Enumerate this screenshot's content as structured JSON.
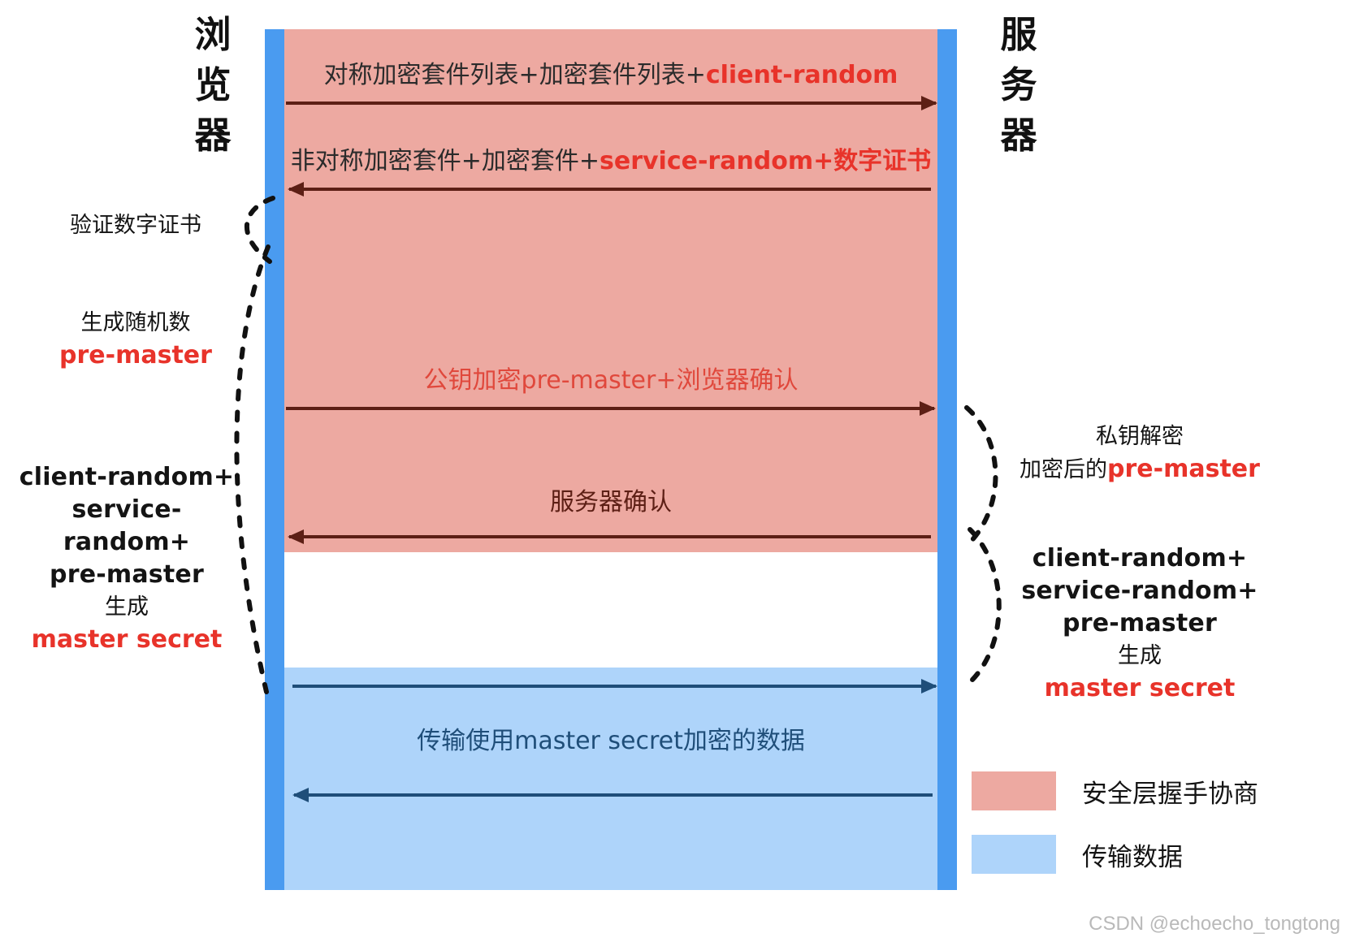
{
  "actors": {
    "left": "浏览器",
    "right": "服务器"
  },
  "bands": {
    "handshake_color": "#eda9a1",
    "transfer_color": "#aed4fa",
    "lifeline_color": "#4a9bf0"
  },
  "messages": [
    {
      "id": "client-hello",
      "direction": "right",
      "cn_prefix": "对称加密套件列表+加密套件列表+",
      "highlight": "client-random",
      "cn_suffix": ""
    },
    {
      "id": "server-hello",
      "direction": "left",
      "cn_prefix": "非对称加密套件+加密套件+",
      "highlight": "service-random",
      "cn_suffix": "+数字证书"
    },
    {
      "id": "client-key-exchange",
      "direction": "right",
      "cn_prefix": "公钥加密",
      "highlight": "pre-master",
      "cn_suffix": "+浏览器确认"
    },
    {
      "id": "server-finished",
      "direction": "left",
      "cn_prefix": "服务器确认",
      "highlight": "",
      "cn_suffix": ""
    },
    {
      "id": "application-data",
      "direction": "both",
      "cn_prefix": "传输使用",
      "highlight": "master secret",
      "cn_suffix": "加密的数据"
    }
  ],
  "notes": {
    "verify_cert": {
      "line1": "验证数字证书"
    },
    "generate_random": {
      "line1": "生成随机数",
      "line2": "pre-master"
    },
    "master_left": {
      "line1": "client-random+",
      "line2": "service-random+",
      "line3": "pre-master",
      "line4": "生成",
      "line5": "master secret"
    },
    "private_key_decrypt": {
      "line1": "私钥解密",
      "line2_cn": "加密后的",
      "line2_red": "pre-master"
    },
    "master_right": {
      "line1": "client-random+",
      "line2": "service-random+",
      "line3": "pre-master",
      "line4": "生成",
      "line5": "master secret"
    }
  },
  "legend": {
    "items": [
      {
        "swatch": "#eda9a1",
        "label": "安全层握手协商"
      },
      {
        "swatch": "#aed4fa",
        "label": "传输数据"
      }
    ]
  },
  "watermark": "CSDN @echoecho_tongtong",
  "colors": {
    "accent_red": "#e8332a",
    "handshake_band": "#eda9a1",
    "transfer_band": "#aed4fa",
    "lifeline_blue": "#4a9bf0",
    "handshake_arrow": "#5d1f15",
    "transfer_arrow": "#1f4e79"
  }
}
